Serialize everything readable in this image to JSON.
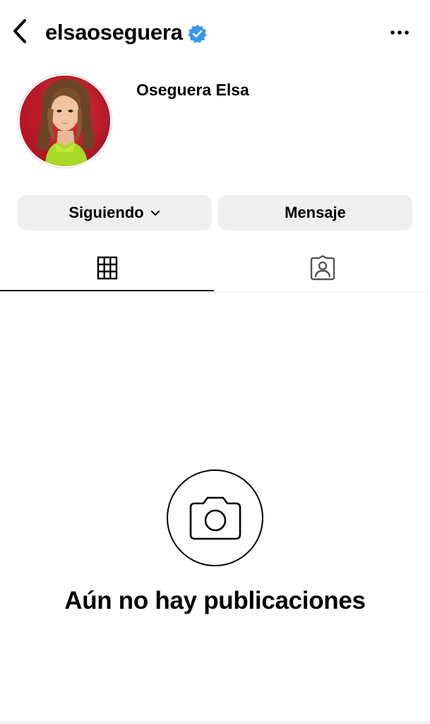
{
  "header": {
    "username": "elsaoseguera",
    "back_icon": "chevron-left-icon",
    "verified_icon": "verified-badge-icon",
    "more_icon": "more-horizontal-icon"
  },
  "profile": {
    "display_name": "Oseguera Elsa",
    "avatar_icon": "profile-photo"
  },
  "actions": {
    "follow_label": "Siguiendo",
    "follow_icon": "chevron-down-icon",
    "message_label": "Mensaje"
  },
  "tabs": [
    {
      "name": "grid",
      "icon": "grid-icon",
      "active": true
    },
    {
      "name": "tagged",
      "icon": "tagged-user-icon",
      "active": false
    }
  ],
  "empty_state": {
    "icon": "camera-icon",
    "title": "Aún no hay publicaciones"
  },
  "colors": {
    "accent_verified": "#3897f0",
    "button_bg": "#efefef",
    "divider": "#efefef"
  }
}
